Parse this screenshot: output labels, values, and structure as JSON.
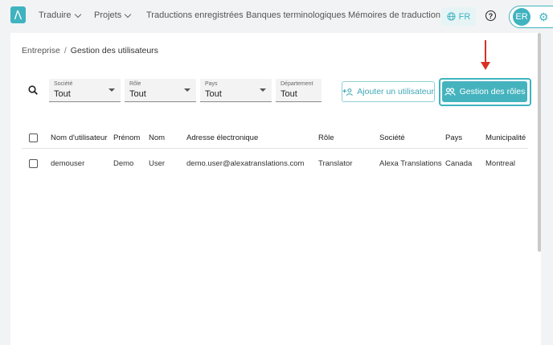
{
  "nav": {
    "items": [
      {
        "label": "Traduire",
        "dropdown": true
      },
      {
        "label": "Projets",
        "dropdown": true
      },
      {
        "label": "Traductions enregistrées",
        "dropdown": false
      },
      {
        "label": "Banques terminologiques",
        "dropdown": false
      },
      {
        "label": "Mémoires de traduction",
        "dropdown": false
      }
    ],
    "language": "FR",
    "user_initials": "ER"
  },
  "breadcrumb": {
    "parent": "Entreprise",
    "separator": "/",
    "current": "Gestion des utilisateurs"
  },
  "filters": [
    {
      "label": "Société",
      "value": "Tout",
      "dropdown": true
    },
    {
      "label": "Rôle",
      "value": "Tout",
      "dropdown": true
    },
    {
      "label": "Pays",
      "value": "Tout",
      "dropdown": true
    },
    {
      "label": "Département",
      "value": "Tout",
      "dropdown": false
    }
  ],
  "actions": {
    "add_user": "Ajouter un utilisateur",
    "manage_roles": "Gestion des rôles"
  },
  "table": {
    "columns": [
      "Nom d'utilisateur",
      "Prénom",
      "Nom",
      "Adresse électronique",
      "Rôle",
      "Société",
      "Pays",
      "Municipalité"
    ],
    "rows": [
      [
        "demouser",
        "Demo",
        "User",
        "demo.user@alexatranslations.com",
        "Translator",
        "Alexa Translations",
        "Canada",
        "Montreal"
      ]
    ]
  },
  "colors": {
    "accent": "#3fb3bf",
    "annotation_arrow": "#d93025"
  }
}
